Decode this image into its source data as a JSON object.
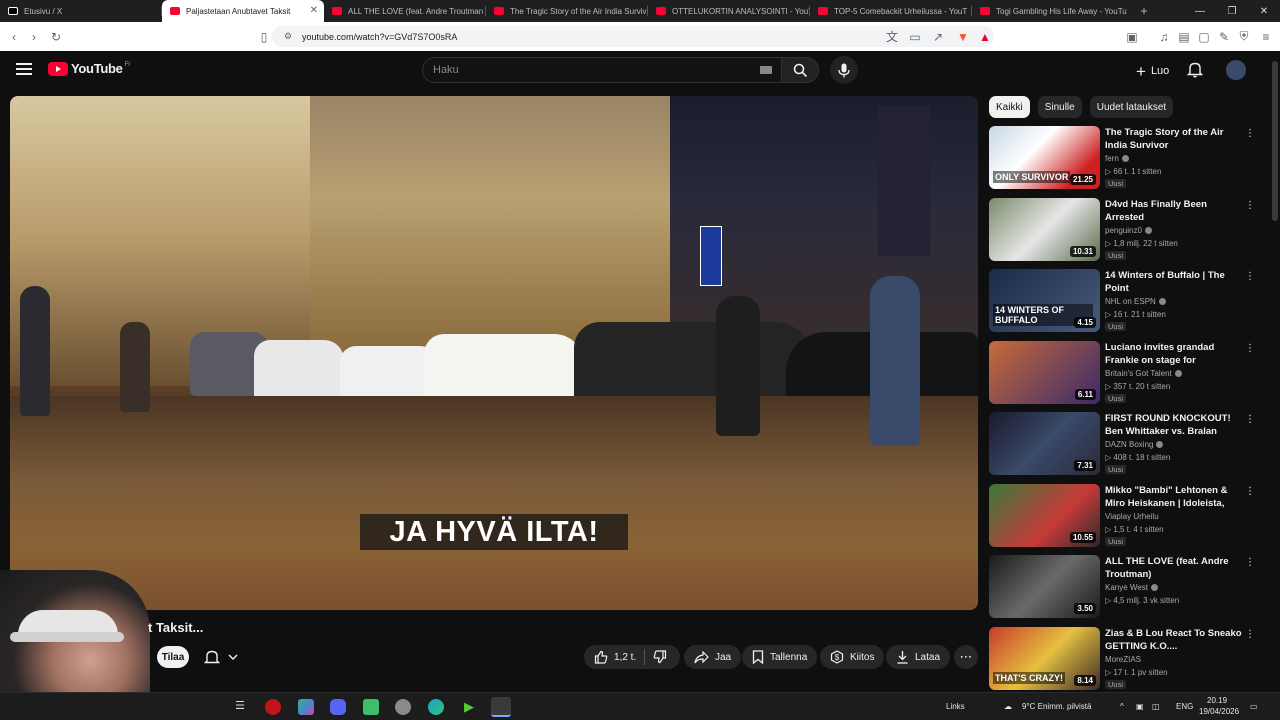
{
  "browser": {
    "tabs": [
      {
        "label": "Etusivu / X",
        "active": false
      },
      {
        "label": "Paljastetaan Anubtavet Taksit",
        "active": true
      },
      {
        "label": "ALL THE LOVE (feat. Andre Troutman",
        "active": false
      },
      {
        "label": "The Tragic Story of the Air India Surviv",
        "active": false
      },
      {
        "label": "OTTELUKORTIN ANALYSOINTI - YouT",
        "active": false
      },
      {
        "label": "TOP-5 Comebackit Urheilussa - YouT",
        "active": false
      },
      {
        "label": "Togi Gambling His Life Away - YouTu",
        "active": false
      }
    ],
    "url": "youtube.com/watch?v=GVd7S7O0sRA"
  },
  "header": {
    "logo_text": "YouTube",
    "country": "FI",
    "search_placeholder": "Haku",
    "create_label": "Luo"
  },
  "video": {
    "caption": "JA HYVÄ ILTA!",
    "title": "t Taksit...",
    "subscribe_label": "Tilaa",
    "actions": {
      "likes": "1,2 t.",
      "share": "Jaa",
      "save": "Tallenna",
      "thanks": "Kiitos",
      "download": "Lataa"
    }
  },
  "chips": [
    "Kaikki",
    "Sinulle",
    "Uudet lataukset"
  ],
  "recommendations": [
    {
      "title": "The Tragic Story of the Air India Survivor",
      "channel": "fern",
      "verified": true,
      "meta": "66 t. 1 t sitten",
      "badge": "Uusi",
      "duration": "21.25",
      "thumb_text": "ONLY SURVIVOR"
    },
    {
      "title": "D4vd Has Finally Been Arrested",
      "channel": "penguinz0",
      "verified": true,
      "meta": "1,8 milj. 22 t sitten",
      "badge": "Uusi",
      "duration": "10.31",
      "thumb_text": ""
    },
    {
      "title": "14 Winters of Buffalo | The Point",
      "channel": "NHL on ESPN",
      "verified": true,
      "meta": "16 t. 21 t sitten",
      "badge": "Uusi",
      "duration": "4.15",
      "thumb_text": "14 WINTERS OF BUFFALO"
    },
    {
      "title": "Luciano invites grandad Frankie on stage for emotiona...",
      "channel": "Britain's Got Talent",
      "verified": true,
      "meta": "357 t. 20 t sitten",
      "badge": "Uusi",
      "duration": "6.11",
      "thumb_text": ""
    },
    {
      "title": "FIRST ROUND KNOCKOUT! Ben Whittaker vs. Bralan Suarez | ...",
      "channel": "DAZN Boxing",
      "verified": true,
      "meta": "408 t. 18 t sitten",
      "badge": "Uusi",
      "duration": "7.31",
      "thumb_text": ""
    },
    {
      "title": "Mikko \"Bambi\" Lehtonen & Miro Heiskanen | Idoleista, urasta &...",
      "channel": "Viaplay Urheilu",
      "verified": false,
      "meta": "1,5 t. 4 t sitten",
      "badge": "Uusi",
      "duration": "10.55",
      "thumb_text": ""
    },
    {
      "title": "ALL THE LOVE (feat. Andre Troutman)",
      "channel": "Kanye West",
      "verified": true,
      "meta": "4,5 milj. 3 vk sitten",
      "badge": "",
      "duration": "3.50",
      "thumb_text": ""
    },
    {
      "title": "Zias & B Lou React To Sneako GETTING K.O....",
      "channel": "MoreZIAS",
      "verified": false,
      "meta": "17 t. 1 pv sitten",
      "badge": "Uusi",
      "duration": "8.14",
      "thumb_text": "THAT'S CRAZY!"
    }
  ],
  "taskbar": {
    "links": "Links",
    "weather": "9°C Enimm. pilvistä",
    "lang": "ENG",
    "time": "20.19",
    "date": "19/04/2026"
  },
  "colors": {
    "accent_red": "#ff0033",
    "background": "#0f0f0f",
    "chip_bg": "#272727"
  }
}
